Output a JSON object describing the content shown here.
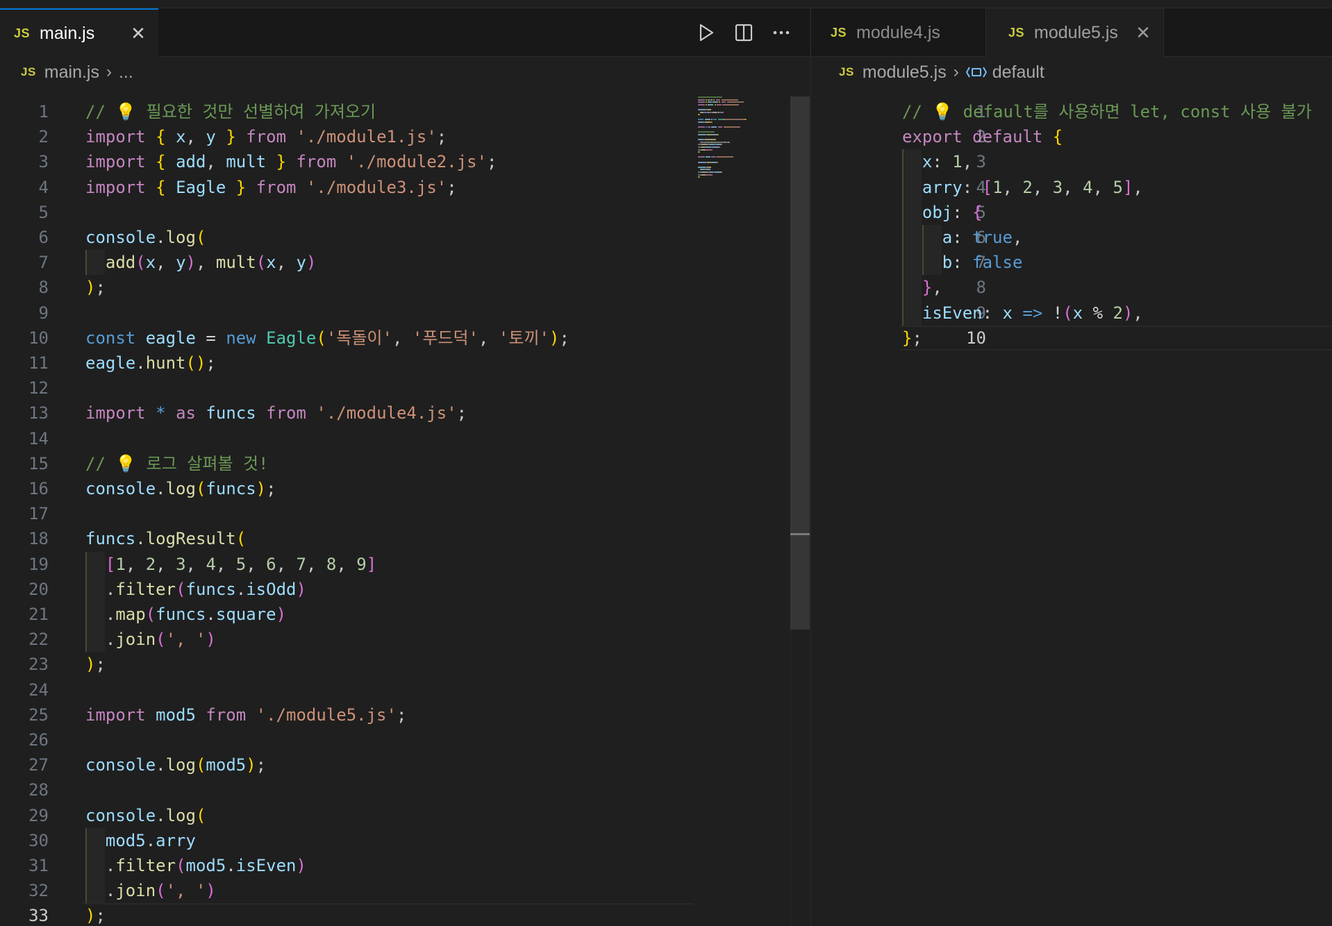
{
  "left": {
    "tab": {
      "icon": "JS",
      "label": "main.js"
    },
    "breadcrumb": {
      "icon": "JS",
      "file": "main.js",
      "rest": "..."
    },
    "actions": [
      "run-icon",
      "split-editor-icon",
      "more-actions-icon"
    ],
    "lines": [
      [
        [
          "c",
          "// 💡 필요한 것만 선별하여 가져오기"
        ]
      ],
      [
        [
          "k",
          "import"
        ],
        [
          "p",
          " "
        ],
        [
          "b1",
          "{"
        ],
        [
          "p",
          " "
        ],
        [
          "v",
          "x"
        ],
        [
          "p",
          ", "
        ],
        [
          "v",
          "y"
        ],
        [
          "p",
          " "
        ],
        [
          "b1",
          "}"
        ],
        [
          "p",
          " "
        ],
        [
          "k",
          "from"
        ],
        [
          "p",
          " "
        ],
        [
          "s",
          "'./module1.js'"
        ],
        [
          "p",
          ";"
        ]
      ],
      [
        [
          "k",
          "import"
        ],
        [
          "p",
          " "
        ],
        [
          "b1",
          "{"
        ],
        [
          "p",
          " "
        ],
        [
          "v",
          "add"
        ],
        [
          "p",
          ", "
        ],
        [
          "v",
          "mult"
        ],
        [
          "p",
          " "
        ],
        [
          "b1",
          "}"
        ],
        [
          "p",
          " "
        ],
        [
          "k",
          "from"
        ],
        [
          "p",
          " "
        ],
        [
          "s",
          "'./module2.js'"
        ],
        [
          "p",
          ";"
        ]
      ],
      [
        [
          "k",
          "import"
        ],
        [
          "p",
          " "
        ],
        [
          "b1",
          "{"
        ],
        [
          "p",
          " "
        ],
        [
          "v",
          "Eagle"
        ],
        [
          "p",
          " "
        ],
        [
          "b1",
          "}"
        ],
        [
          "p",
          " "
        ],
        [
          "k",
          "from"
        ],
        [
          "p",
          " "
        ],
        [
          "s",
          "'./module3.js'"
        ],
        [
          "p",
          ";"
        ]
      ],
      [],
      [
        [
          "v",
          "console"
        ],
        [
          "p",
          "."
        ],
        [
          "f",
          "log"
        ],
        [
          "b1",
          "("
        ]
      ],
      [
        [
          "p",
          "  "
        ],
        [
          "f",
          "add"
        ],
        [
          "b2",
          "("
        ],
        [
          "v",
          "x"
        ],
        [
          "p",
          ", "
        ],
        [
          "v",
          "y"
        ],
        [
          "b2",
          ")"
        ],
        [
          "p",
          ", "
        ],
        [
          "f",
          "mult"
        ],
        [
          "b2",
          "("
        ],
        [
          "v",
          "x"
        ],
        [
          "p",
          ", "
        ],
        [
          "v",
          "y"
        ],
        [
          "b2",
          ")"
        ]
      ],
      [
        [
          "b1",
          ")"
        ],
        [
          "p",
          ";"
        ]
      ],
      [],
      [
        [
          "kb",
          "const"
        ],
        [
          "p",
          " "
        ],
        [
          "v",
          "eagle"
        ],
        [
          "p",
          " "
        ],
        [
          "o",
          "="
        ],
        [
          "p",
          " "
        ],
        [
          "kb",
          "new"
        ],
        [
          "p",
          " "
        ],
        [
          "t",
          "Eagle"
        ],
        [
          "b1",
          "("
        ],
        [
          "s",
          "'독돌이'"
        ],
        [
          "p",
          ", "
        ],
        [
          "s",
          "'푸드덕'"
        ],
        [
          "p",
          ", "
        ],
        [
          "s",
          "'토끼'"
        ],
        [
          "b1",
          ")"
        ],
        [
          "p",
          ";"
        ]
      ],
      [
        [
          "v",
          "eagle"
        ],
        [
          "p",
          "."
        ],
        [
          "f",
          "hunt"
        ],
        [
          "b1",
          "()"
        ],
        [
          "p",
          ";"
        ]
      ],
      [],
      [
        [
          "k",
          "import"
        ],
        [
          "p",
          " "
        ],
        [
          "kb",
          "*"
        ],
        [
          "p",
          " "
        ],
        [
          "k",
          "as"
        ],
        [
          "p",
          " "
        ],
        [
          "v",
          "funcs"
        ],
        [
          "p",
          " "
        ],
        [
          "k",
          "from"
        ],
        [
          "p",
          " "
        ],
        [
          "s",
          "'./module4.js'"
        ],
        [
          "p",
          ";"
        ]
      ],
      [],
      [
        [
          "c",
          "// 💡 로그 살펴볼 것!"
        ]
      ],
      [
        [
          "v",
          "console"
        ],
        [
          "p",
          "."
        ],
        [
          "f",
          "log"
        ],
        [
          "b1",
          "("
        ],
        [
          "v",
          "funcs"
        ],
        [
          "b1",
          ")"
        ],
        [
          "p",
          ";"
        ]
      ],
      [],
      [
        [
          "v",
          "funcs"
        ],
        [
          "p",
          "."
        ],
        [
          "f",
          "logResult"
        ],
        [
          "b1",
          "("
        ]
      ],
      [
        [
          "p",
          "  "
        ],
        [
          "b2",
          "["
        ],
        [
          "n",
          "1"
        ],
        [
          "p",
          ", "
        ],
        [
          "n",
          "2"
        ],
        [
          "p",
          ", "
        ],
        [
          "n",
          "3"
        ],
        [
          "p",
          ", "
        ],
        [
          "n",
          "4"
        ],
        [
          "p",
          ", "
        ],
        [
          "n",
          "5"
        ],
        [
          "p",
          ", "
        ],
        [
          "n",
          "6"
        ],
        [
          "p",
          ", "
        ],
        [
          "n",
          "7"
        ],
        [
          "p",
          ", "
        ],
        [
          "n",
          "8"
        ],
        [
          "p",
          ", "
        ],
        [
          "n",
          "9"
        ],
        [
          "b2",
          "]"
        ]
      ],
      [
        [
          "p",
          "  ."
        ],
        [
          "f",
          "filter"
        ],
        [
          "b2",
          "("
        ],
        [
          "v",
          "funcs"
        ],
        [
          "p",
          "."
        ],
        [
          "v",
          "isOdd"
        ],
        [
          "b2",
          ")"
        ]
      ],
      [
        [
          "p",
          "  ."
        ],
        [
          "f",
          "map"
        ],
        [
          "b2",
          "("
        ],
        [
          "v",
          "funcs"
        ],
        [
          "p",
          "."
        ],
        [
          "v",
          "square"
        ],
        [
          "b2",
          ")"
        ]
      ],
      [
        [
          "p",
          "  ."
        ],
        [
          "f",
          "join"
        ],
        [
          "b2",
          "("
        ],
        [
          "s",
          "', '"
        ],
        [
          "b2",
          ")"
        ]
      ],
      [
        [
          "b1",
          ")"
        ],
        [
          "p",
          ";"
        ]
      ],
      [],
      [
        [
          "k",
          "import"
        ],
        [
          "p",
          " "
        ],
        [
          "v",
          "mod5"
        ],
        [
          "p",
          " "
        ],
        [
          "k",
          "from"
        ],
        [
          "p",
          " "
        ],
        [
          "s",
          "'./module5.js'"
        ],
        [
          "p",
          ";"
        ]
      ],
      [],
      [
        [
          "v",
          "console"
        ],
        [
          "p",
          "."
        ],
        [
          "f",
          "log"
        ],
        [
          "b1",
          "("
        ],
        [
          "v",
          "mod5"
        ],
        [
          "b1",
          ")"
        ],
        [
          "p",
          ";"
        ]
      ],
      [],
      [
        [
          "v",
          "console"
        ],
        [
          "p",
          "."
        ],
        [
          "f",
          "log"
        ],
        [
          "b1",
          "("
        ]
      ],
      [
        [
          "p",
          "  "
        ],
        [
          "v",
          "mod5"
        ],
        [
          "p",
          "."
        ],
        [
          "v",
          "arry"
        ]
      ],
      [
        [
          "p",
          "  ."
        ],
        [
          "f",
          "filter"
        ],
        [
          "b2",
          "("
        ],
        [
          "v",
          "mod5"
        ],
        [
          "p",
          "."
        ],
        [
          "v",
          "isEven"
        ],
        [
          "b2",
          ")"
        ]
      ],
      [
        [
          "p",
          "  ."
        ],
        [
          "f",
          "join"
        ],
        [
          "b2",
          "("
        ],
        [
          "s",
          "', '"
        ],
        [
          "b2",
          ")"
        ]
      ],
      [
        [
          "b1",
          ")"
        ],
        [
          "p",
          ";"
        ]
      ]
    ],
    "current_line": 33
  },
  "right": {
    "tabs": [
      {
        "icon": "JS",
        "label": "module4.js",
        "active": false
      },
      {
        "icon": "JS",
        "label": "module5.js",
        "active": true
      }
    ],
    "breadcrumb": {
      "icon": "JS",
      "file": "module5.js",
      "symbol_icon": "symbol-field-icon",
      "symbol": "default"
    },
    "lines": [
      [
        [
          "c",
          "// 💡 default를 사용하면 let, const 사용 불가"
        ]
      ],
      [
        [
          "k",
          "export"
        ],
        [
          "p",
          " "
        ],
        [
          "k",
          "default"
        ],
        [
          "p",
          " "
        ],
        [
          "b1",
          "{"
        ]
      ],
      [
        [
          "p",
          "  "
        ],
        [
          "v",
          "x"
        ],
        [
          "p",
          ": "
        ],
        [
          "n",
          "1"
        ],
        [
          "p",
          ","
        ]
      ],
      [
        [
          "p",
          "  "
        ],
        [
          "v",
          "arry"
        ],
        [
          "p",
          ": "
        ],
        [
          "b2",
          "["
        ],
        [
          "n",
          "1"
        ],
        [
          "p",
          ", "
        ],
        [
          "n",
          "2"
        ],
        [
          "p",
          ", "
        ],
        [
          "n",
          "3"
        ],
        [
          "p",
          ", "
        ],
        [
          "n",
          "4"
        ],
        [
          "p",
          ", "
        ],
        [
          "n",
          "5"
        ],
        [
          "b2",
          "]"
        ],
        [
          "p",
          ","
        ]
      ],
      [
        [
          "p",
          "  "
        ],
        [
          "v",
          "obj"
        ],
        [
          "p",
          ": "
        ],
        [
          "b2",
          "{"
        ]
      ],
      [
        [
          "p",
          "    "
        ],
        [
          "v",
          "a"
        ],
        [
          "p",
          ": "
        ],
        [
          "kb",
          "true"
        ],
        [
          "p",
          ","
        ]
      ],
      [
        [
          "p",
          "    "
        ],
        [
          "v",
          "b"
        ],
        [
          "p",
          ": "
        ],
        [
          "kb",
          "false"
        ]
      ],
      [
        [
          "p",
          "  "
        ],
        [
          "b2",
          "}"
        ],
        [
          "p",
          ","
        ]
      ],
      [
        [
          "p",
          "  "
        ],
        [
          "v",
          "isEven"
        ],
        [
          "p",
          ": "
        ],
        [
          "v",
          "x"
        ],
        [
          "p",
          " "
        ],
        [
          "kb",
          "=>"
        ],
        [
          "p",
          " "
        ],
        [
          "o",
          "!"
        ],
        [
          "b2",
          "("
        ],
        [
          "v",
          "x"
        ],
        [
          "p",
          " "
        ],
        [
          "o",
          "%"
        ],
        [
          "p",
          " "
        ],
        [
          "n",
          "2"
        ],
        [
          "b2",
          ")"
        ],
        [
          "p",
          ","
        ]
      ],
      [
        [
          "b1",
          "}"
        ],
        [
          "p",
          ";"
        ]
      ]
    ],
    "current_line": 10
  }
}
